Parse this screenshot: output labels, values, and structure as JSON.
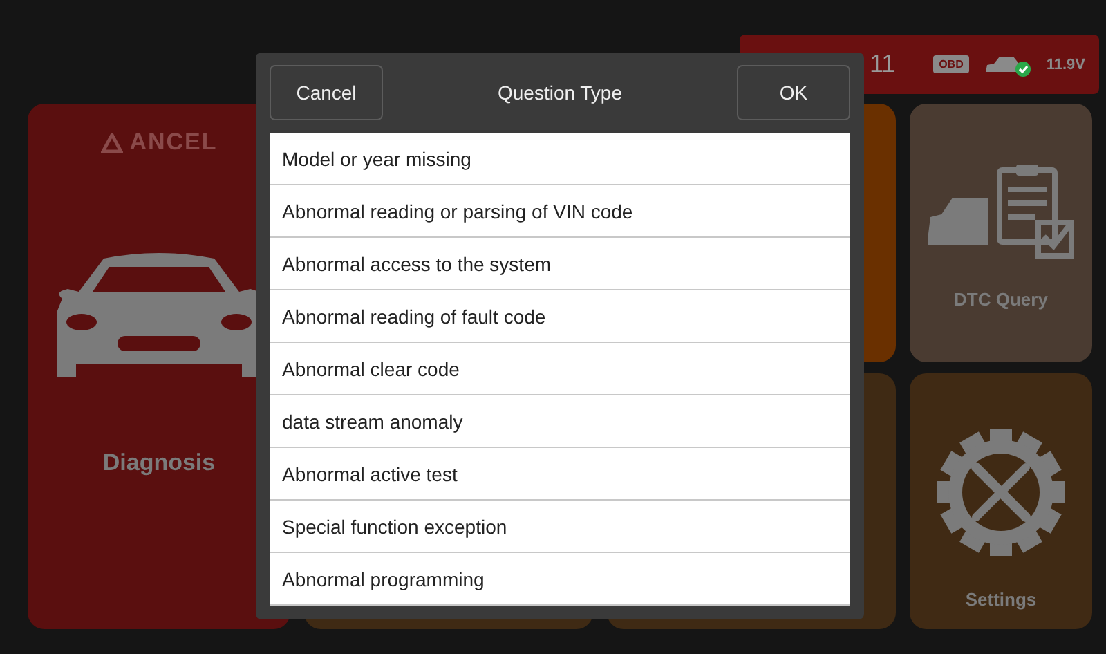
{
  "status_bar": {
    "partial_text": "11",
    "battery_label": "OBD",
    "voltage": "11.9V"
  },
  "tiles": [
    {
      "kind": "diagnosis",
      "logo": "ANCEL",
      "label": "Diagnosis",
      "color": "#5a0f0f"
    },
    {
      "kind": "covered",
      "color": "#6a3000"
    },
    {
      "kind": "dtc",
      "label": "DTC Query",
      "color": "#4a3b31"
    },
    {
      "kind": "covered",
      "color": "#3f2a14"
    },
    {
      "kind": "covered",
      "color": "#3f2a14"
    },
    {
      "kind": "settings",
      "label": "Settings",
      "color": "#402a14"
    }
  ],
  "dialog": {
    "cancel": "Cancel",
    "title": "Question Type",
    "ok": "OK",
    "options": [
      "Model or year missing",
      "Abnormal reading or parsing of VIN code",
      "Abnormal access to the system",
      "Abnormal reading of fault code",
      "Abnormal clear code",
      "data stream anomaly",
      "Abnormal active test",
      "Special function exception",
      "Abnormal programming"
    ]
  }
}
